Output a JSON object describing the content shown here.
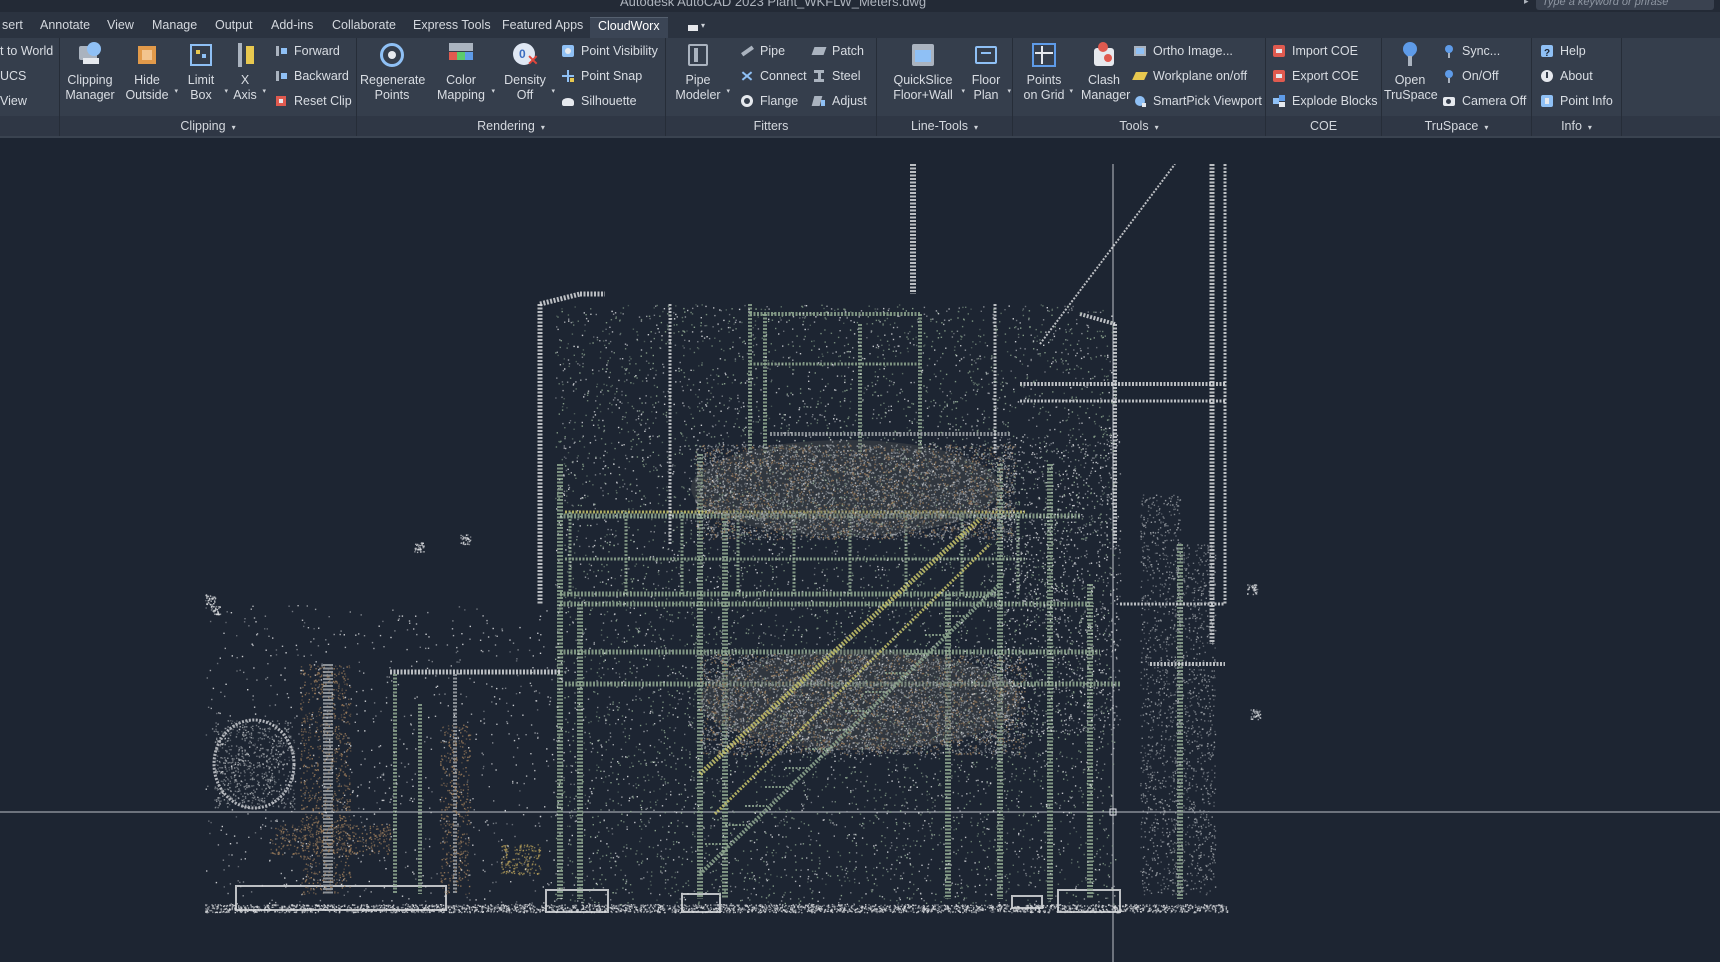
{
  "window": {
    "title": "Autodesk AutoCAD 2023    Plant_WKFLW_Meters.dwg",
    "search_placeholder": "Type a keyword or phrase"
  },
  "tabs": [
    {
      "label": "sert"
    },
    {
      "label": "Annotate"
    },
    {
      "label": "View"
    },
    {
      "label": "Manage"
    },
    {
      "label": "Output"
    },
    {
      "label": "Add-ins"
    },
    {
      "label": "Collaborate"
    },
    {
      "label": "Express Tools"
    },
    {
      "label": "Featured Apps"
    },
    {
      "label": "CloudWorx",
      "active": true
    }
  ],
  "ribbon": {
    "ucs": {
      "to_world": "t to World",
      "ucs": "UCS",
      "view": "View"
    },
    "clipping": {
      "title": "Clipping",
      "clipping_manager": [
        "Clipping",
        "Manager"
      ],
      "hide_outside": [
        "Hide",
        "Outside"
      ],
      "limit_box": [
        "Limit",
        "Box"
      ],
      "x_axis": [
        "X",
        "Axis"
      ],
      "forward": "Forward",
      "backward": "Backward",
      "reset_clip": "Reset Clip"
    },
    "rendering": {
      "title": "Rendering",
      "regenerate_points": [
        "Regenerate",
        "Points"
      ],
      "color_mapping": [
        "Color",
        "Mapping"
      ],
      "density_off": [
        "Density",
        "Off"
      ],
      "point_visibility": "Point Visibility",
      "point_snap": "Point Snap",
      "silhouette": "Silhouette"
    },
    "fitters": {
      "title": "Fitters",
      "pipe_modeler": [
        "Pipe",
        "Modeler"
      ],
      "pipe": "Pipe",
      "connect": "Connect",
      "flange": "Flange",
      "patch": "Patch",
      "steel": "Steel",
      "adjust": "Adjust"
    },
    "line_tools": {
      "title": "Line-Tools",
      "quickslice": [
        "QuickSlice",
        "Floor+Wall"
      ],
      "floor_plan": [
        "Floor",
        "Plan"
      ]
    },
    "tools": {
      "title": "Tools",
      "points_on_grid": [
        "Points",
        "on Grid"
      ],
      "clash_manager": [
        "Clash",
        "Manager"
      ],
      "ortho_image": "Ortho Image...",
      "workplane": "Workplane on/off",
      "smartpick": "SmartPick Viewport"
    },
    "coe": {
      "title": "COE",
      "import_coe": "Import COE",
      "export_coe": "Export COE",
      "explode_blocks": "Explode Blocks"
    },
    "truspace": {
      "title": "TruSpace",
      "open_truspace": [
        "Open",
        "TruSpace"
      ],
      "sync": "Sync...",
      "onoff": "On/Off",
      "camera_off": "Camera Off"
    },
    "info": {
      "title": "Info",
      "help": "Help",
      "about": "About",
      "point_info": "Point Info"
    }
  },
  "colors": {
    "viewport_bg": "#1d2532",
    "ribbon_bg": "#353e4c",
    "steel_green": "#8fa890",
    "stair_yellow": "#c9c56a",
    "pipe_white": "#d8dadd"
  }
}
